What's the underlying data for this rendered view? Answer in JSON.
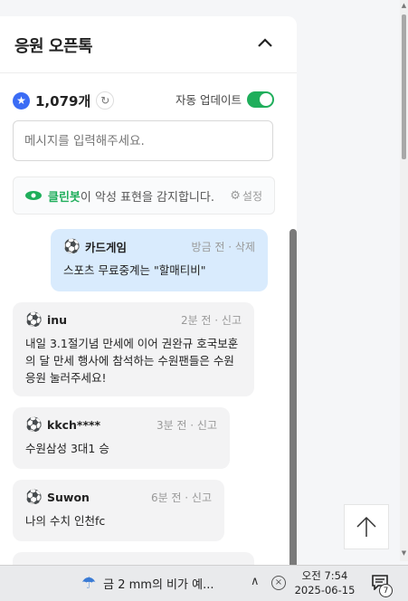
{
  "panel": {
    "title": "응원 오픈톡",
    "count": "1,079개",
    "auto_update_label": "자동 업데이트",
    "input_placeholder": "메시지를 입력해주세요.",
    "cleanbot_name": "클린봇",
    "cleanbot_text": "이 악성 표현을 감지합니다.",
    "settings_label": "설정"
  },
  "messages": [
    {
      "nick": "카드게임",
      "meta": "방금 전 · 삭제",
      "text": "스포츠 무료중계는 \"할매티비\"",
      "mine": true
    },
    {
      "nick": "inu",
      "meta": "2분 전 · 신고",
      "text": "내일 3.1절기념 만세에 이어 권완규 호국보훈의 달 만세 행사에 참석하는 수원팬들은 수원 응원 눌러주세요!",
      "mine": false
    },
    {
      "nick": "kkch****",
      "meta": "3분 전 · 신고",
      "text": "수원삼성 3대1 승",
      "mine": false
    },
    {
      "nick": "Suwon",
      "meta": "6분 전 · 신고",
      "text": "나의 수치 인천fc",
      "mine": false
    }
  ],
  "taskbar": {
    "weather": "금 2 mm의 비가 예...",
    "time": "오전 7:54",
    "date": "2025-06-15",
    "notif_count": "7"
  },
  "colors": {
    "accent_green": "#1fae5b",
    "accent_blue": "#3b6cf5",
    "my_bubble": "#d9ebfd"
  }
}
